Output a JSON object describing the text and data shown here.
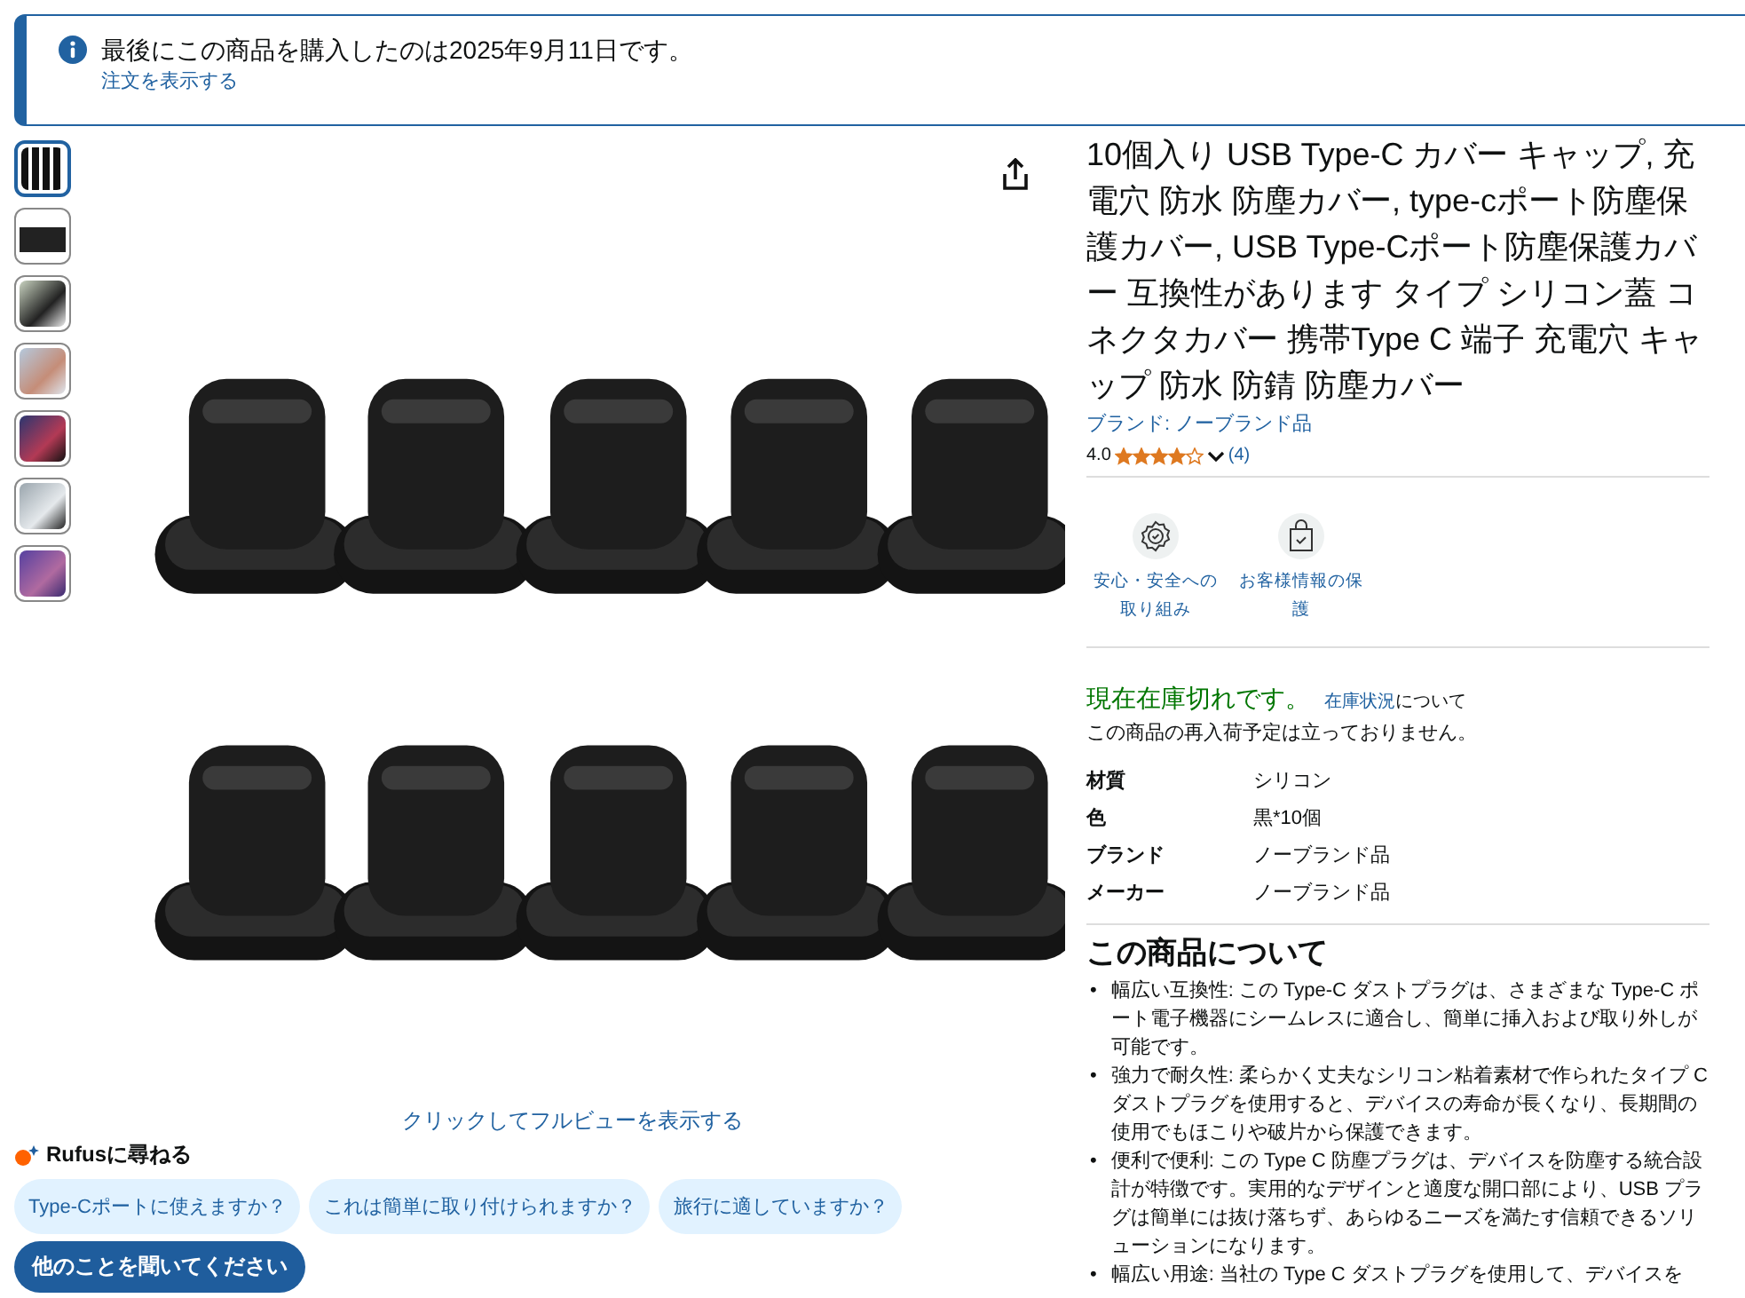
{
  "notice": {
    "message": "最後にこの商品を購入したのは2025年9月11日です。",
    "link": "注文を表示する"
  },
  "gallery": {
    "thumbnails": [
      {
        "selected": true,
        "kind": "plugs"
      },
      {
        "selected": false,
        "kind": "plug"
      },
      {
        "selected": false,
        "kind": "phone"
      },
      {
        "selected": false,
        "kind": "hand"
      },
      {
        "selected": false,
        "kind": "dark"
      },
      {
        "selected": false,
        "kind": "light"
      },
      {
        "selected": false,
        "kind": "purple"
      }
    ],
    "caption": "クリックしてフルビューを表示する"
  },
  "rufus": {
    "title": "Rufusに尋ねる",
    "suggestions": [
      "Type-Cポートに使えますか？",
      "これは簡単に取り付けられますか？",
      "旅行に適していますか？"
    ],
    "ask_button": "他のことを聞いてください"
  },
  "product": {
    "title": "10個入り USB Type-C カバー キャップ, 充電穴 防水 防塵カバー, type-cポート防塵保護カバー, USB Type-Cポート防塵保護カバー 互換性があります タイプ シリコン蓋 コネクタカバー 携帯Type C 端子 充電穴 キャップ 防水 防錆 防塵カバー",
    "brand_link": "ブランド: ノーブランド品",
    "rating": "4.0",
    "stars": 4,
    "review_count": "(4)",
    "badges": [
      {
        "label": "安心・安全への取り組み",
        "kind": "shield"
      },
      {
        "label": "お客様情報の保護",
        "kind": "bag"
      }
    ],
    "availability": "現在在庫切れです。",
    "stock_link": "在庫状況",
    "stock_suffix": "について",
    "restock_note": "この商品の再入荷予定は立っておりません。",
    "specs": [
      {
        "label": "材質",
        "value": "シリコン"
      },
      {
        "label": "色",
        "value": "黒*10個"
      },
      {
        "label": "ブランド",
        "value": "ノーブランド品"
      },
      {
        "label": "メーカー",
        "value": "ノーブランド品"
      }
    ],
    "about_heading": "この商品について",
    "bullet_marker": "•",
    "bullets": [
      "幅広い互換性: この Type-C ダストプラグは、さまざまな Type-C ポート電子機器にシームレスに適合し、簡単に挿入および取り外しが可能です。",
      "強力で耐久性: 柔らかく丈夫なシリコン粘着素材で作られたタイプ C ダストプラグを使用すると、デバイスの寿命が長くなり、長期間の使用でもほこりや破片から保護できます。",
      "便利で便利: この Type C 防塵プラグは、デバイスを防塵する統合設計が特徴です。実用的なデザインと適度な開口部により、USB プラグは簡単には抜け落ちず、あらゆるニーズを満たす信頼できるソリューションになります。",
      "幅広い用途: 当社の Type C ダストプラグを使用して、デバイスを"
    ]
  }
}
